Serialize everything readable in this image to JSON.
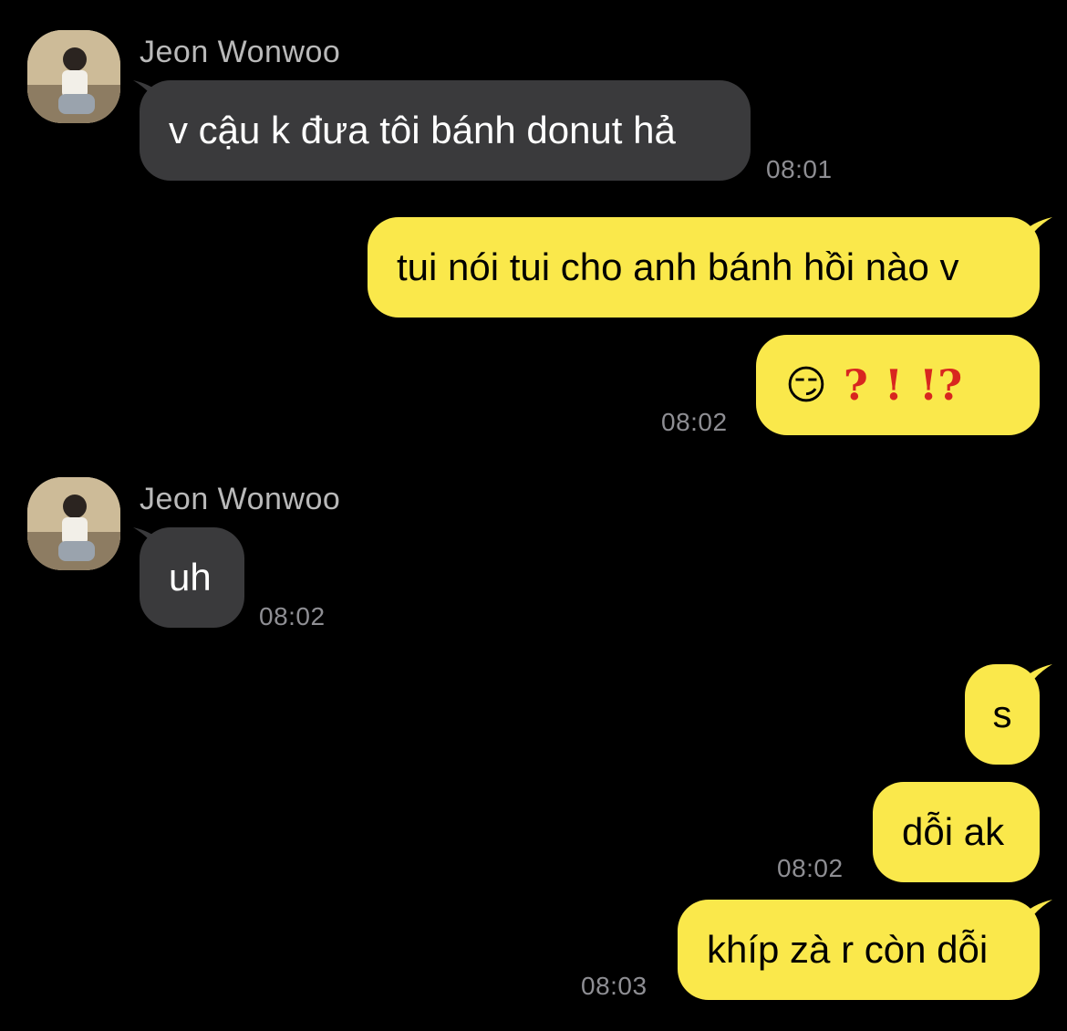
{
  "contact": {
    "name": "Jeon Wonwoo"
  },
  "messages": [
    {
      "from": "them",
      "text": "v cậu k đưa tôi bánh donut hả",
      "time": "08:01"
    },
    {
      "from": "me",
      "text": "tui nói tui cho anh bánh hồi nào v"
    },
    {
      "from": "me",
      "emoji": [
        "😏",
        "❓",
        "❗",
        "⁉️"
      ],
      "time": "08:02"
    },
    {
      "from": "them",
      "text": "uh",
      "time": "08:02"
    },
    {
      "from": "me",
      "text": "s"
    },
    {
      "from": "me",
      "text": "dỗi ak",
      "time": "08:02"
    },
    {
      "from": "me",
      "text": "khíp zà r còn dỗi",
      "time": "08:03"
    }
  ],
  "colors": {
    "incoming_bubble": "#3a3a3c",
    "outgoing_bubble": "#fae84b",
    "background": "#000000",
    "timestamp": "#8e8e93"
  }
}
